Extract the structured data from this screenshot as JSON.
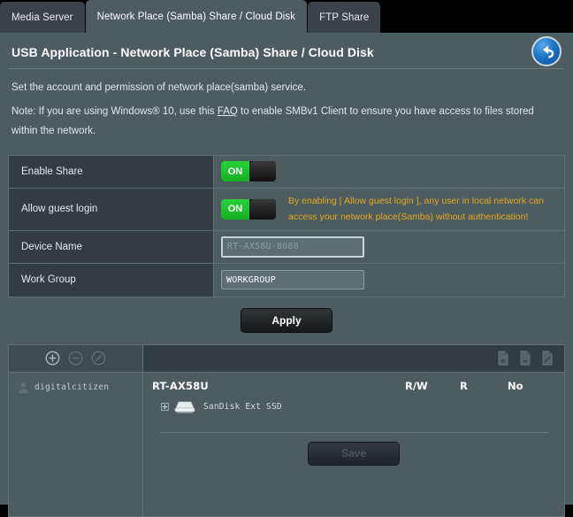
{
  "tabs": [
    {
      "label": "Media Server",
      "active": false
    },
    {
      "label": "Network Place (Samba) Share / Cloud Disk",
      "active": true
    },
    {
      "label": "FTP Share",
      "active": false
    }
  ],
  "header": {
    "title": "USB Application - Network Place (Samba) Share / Cloud Disk",
    "back_button_icon": "back-arrow-icon"
  },
  "intro": {
    "description": "Set the account and permission of network place(samba) service.",
    "note_before": "Note: If you are using Windows® 10, use this ",
    "note_link": "FAQ",
    "note_after": " to enable SMBv1 Client to ensure you have access to files stored within the network."
  },
  "settings": {
    "rows": [
      {
        "label": "Enable Share",
        "type": "toggle",
        "state": "ON"
      },
      {
        "label": "Allow guest login",
        "type": "toggle",
        "state": "ON",
        "warning": "By enabling [ Allow guest login ], any user in local network can access your network place(Samba) without authentication!"
      },
      {
        "label": "Device Name",
        "type": "input",
        "value": "",
        "placeholder": "RT-AX58U-8088"
      },
      {
        "label": "Work Group",
        "type": "input",
        "value": "WORKGROUP",
        "placeholder": ""
      }
    ],
    "apply_label": "Apply"
  },
  "share_panel": {
    "toolbar_left_icons": [
      {
        "name": "add-user-icon",
        "enabled": true
      },
      {
        "name": "remove-user-icon",
        "enabled": false
      },
      {
        "name": "edit-user-icon",
        "enabled": false
      }
    ],
    "toolbar_right_icons": [
      {
        "name": "add-folder-icon",
        "enabled": true
      },
      {
        "name": "remove-folder-icon",
        "enabled": true
      },
      {
        "name": "edit-folder-icon",
        "enabled": true
      }
    ],
    "users": [
      {
        "name": "digitalcitizen",
        "avatar": "user-avatar-icon"
      }
    ],
    "device_name": "RT-AX58U",
    "permission_columns": [
      "R/W",
      "R",
      "No"
    ],
    "disks": [
      {
        "label": "SanDisk Ext SSD",
        "icon": "disk-drive-icon",
        "expander": "plus"
      }
    ],
    "save_label": "Save"
  },
  "colors": {
    "page_background": "#4c5c61",
    "label_cell": "#313d41",
    "tab_inactive": "#3a4448",
    "warning_text": "#e5a81a",
    "toggle_on": "#16b024",
    "back_button": "#1d74c4"
  }
}
